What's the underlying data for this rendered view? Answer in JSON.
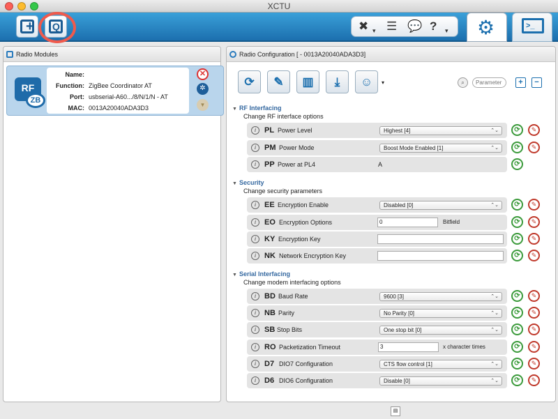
{
  "window": {
    "title": "XCTU"
  },
  "left_panel": {
    "title": "Radio Modules",
    "module": {
      "icon_rf": "RF",
      "icon_zb": "ZB",
      "name_label": "Name:",
      "name_value": "",
      "function_label": "Function:",
      "function_value": "ZigBee Coordinator AT",
      "port_label": "Port:",
      "port_value": "usbserial-A60.../8/N/1/N - AT",
      "mac_label": "MAC:",
      "mac_value": "0013A20040ADA3D3"
    }
  },
  "right_panel": {
    "title": "Radio Configuration [  - 0013A20040ADA3D3]",
    "search": {
      "placeholder": "Parameter"
    },
    "sections": [
      {
        "title": "RF Interfacing",
        "desc": "Change RF interface options",
        "rows": [
          {
            "code": "PL",
            "name": "Power Level",
            "value": "Highest [4]"
          },
          {
            "code": "PM",
            "name": "Power Mode",
            "value": "Boost Mode Enabled [1]"
          },
          {
            "code": "PP",
            "name": "Power at PL4",
            "value": "A"
          }
        ]
      },
      {
        "title": "Security",
        "desc": "Change security parameters",
        "rows": [
          {
            "code": "EE",
            "name": "Encryption Enable",
            "value": "Disabled [0]"
          },
          {
            "code": "EO",
            "name": "Encryption Options",
            "value": "0",
            "unit": "Bitfield"
          },
          {
            "code": "KY",
            "name": "Encryption Key",
            "value": ""
          },
          {
            "code": "NK",
            "name": "Network Encryption Key",
            "value": ""
          }
        ]
      },
      {
        "title": "Serial Interfacing",
        "desc": "Change modem interfacing options",
        "rows": [
          {
            "code": "BD",
            "name": "Baud Rate",
            "value": "9600 [3]"
          },
          {
            "code": "NB",
            "name": "Parity",
            "value": "No Parity [0]"
          },
          {
            "code": "SB",
            "name": "Stop Bits",
            "value": "One stop bit [0]"
          },
          {
            "code": "RO",
            "name": "Packetization Timeout",
            "value": "3",
            "unit": "x character times"
          },
          {
            "code": "D7",
            "name": "DIO7 Configuration",
            "value": "CTS flow control [1]"
          },
          {
            "code": "D6",
            "name": "DIO6 Configuration",
            "value": "Disable [0]"
          }
        ]
      }
    ]
  },
  "icons": {
    "add_device": "add-device-icon",
    "discover": "discover-icon",
    "tools": "tools-icon",
    "configuration": "gear-icon",
    "terminal": "terminal-icon"
  },
  "colors": {
    "accent": "#1c6fae",
    "highlight": "#ef5a4d",
    "read_green": "#3a9a3a",
    "write_red": "#c0392b",
    "section_title": "#3468a0"
  }
}
